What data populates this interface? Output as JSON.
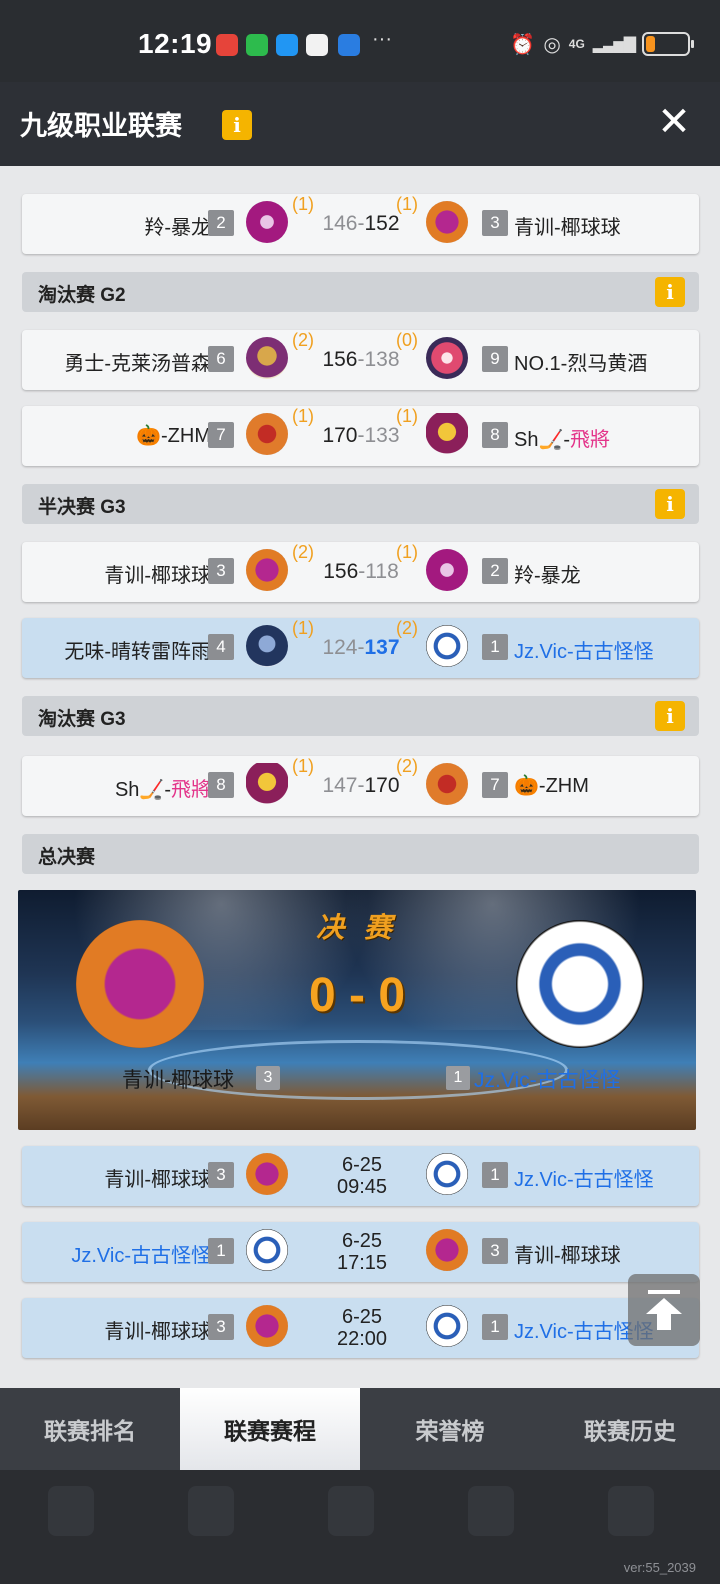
{
  "status_bar": {
    "time": "12:19",
    "network": "4G",
    "dots": "···"
  },
  "header": {
    "title": "九级职业联赛",
    "info": "i",
    "close": "✕"
  },
  "matches": [
    {
      "left_name": "羚-暴龙",
      "left_seed": "2",
      "left_sub": "(1)",
      "left_score": "146",
      "right_score": "152",
      "right_sub": "(1)",
      "right_seed": "3",
      "right_name": "青训-椰球球"
    },
    {
      "left_name": "勇士-克莱汤普森",
      "left_seed": "6",
      "left_sub": "(2)",
      "left_score": "156",
      "right_score": "138",
      "right_sub": "(0)",
      "right_seed": "9",
      "right_name": "NO.1-烈马黄酒"
    },
    {
      "left_name": "🎃-ZHM",
      "left_seed": "7",
      "left_sub": "(1)",
      "left_score": "170",
      "right_score": "133",
      "right_sub": "(1)",
      "right_seed": "8",
      "right_name_a": "Sh🏒-",
      "right_name_b": "飛將"
    },
    {
      "left_name": "青训-椰球球",
      "left_seed": "3",
      "left_sub": "(2)",
      "left_score": "156",
      "right_score": "118",
      "right_sub": "(1)",
      "right_seed": "2",
      "right_name": "羚-暴龙"
    },
    {
      "left_name": "无味-晴转雷阵雨",
      "left_seed": "4",
      "left_sub": "(1)",
      "left_score": "124",
      "right_score": "137",
      "right_sub": "(2)",
      "right_seed": "1",
      "right_name": "Jz.Vic-古古怪怪"
    },
    {
      "left_name_a": "Sh🏒-",
      "left_name_b": "飛將",
      "left_seed": "8",
      "left_sub": "(1)",
      "left_score": "147",
      "right_score": "170",
      "right_sub": "(2)",
      "right_seed": "7",
      "right_name": "🎃-ZHM"
    }
  ],
  "sections": {
    "g2": "淘汰赛 G2",
    "semi_g3": "半决赛 G3",
    "elim_g3": "淘汰赛 G3",
    "finals": "总决赛"
  },
  "final_banner": {
    "title": "决 赛",
    "score": "0 - 0",
    "left_name": "青训-椰球球",
    "left_seed": "3",
    "right_name": "Jz.Vic-古古怪怪",
    "right_seed": "1"
  },
  "schedule": [
    {
      "left_name": "青训-椰球球",
      "left_seed": "3",
      "date": "6-25",
      "time": "09:45",
      "right_seed": "1",
      "right_name": "Jz.Vic-古古怪怪"
    },
    {
      "left_name": "Jz.Vic-古古怪怪",
      "left_seed": "1",
      "date": "6-25",
      "time": "17:15",
      "right_seed": "3",
      "right_name": "青训-椰球球"
    },
    {
      "left_name": "青训-椰球球",
      "left_seed": "3",
      "date": "6-25",
      "time": "22:00",
      "right_seed": "1",
      "right_name": "Jz.Vic-古古怪怪"
    }
  ],
  "tabs": [
    "联赛排名",
    "联赛赛程",
    "荣誉榜",
    "联赛历史"
  ],
  "version": "ver:55_2039",
  "colors": {
    "accent": "#f5b400",
    "blue_team": "#1f6fe6",
    "pink": "#e3348a",
    "sub_score": "#f0a020"
  }
}
